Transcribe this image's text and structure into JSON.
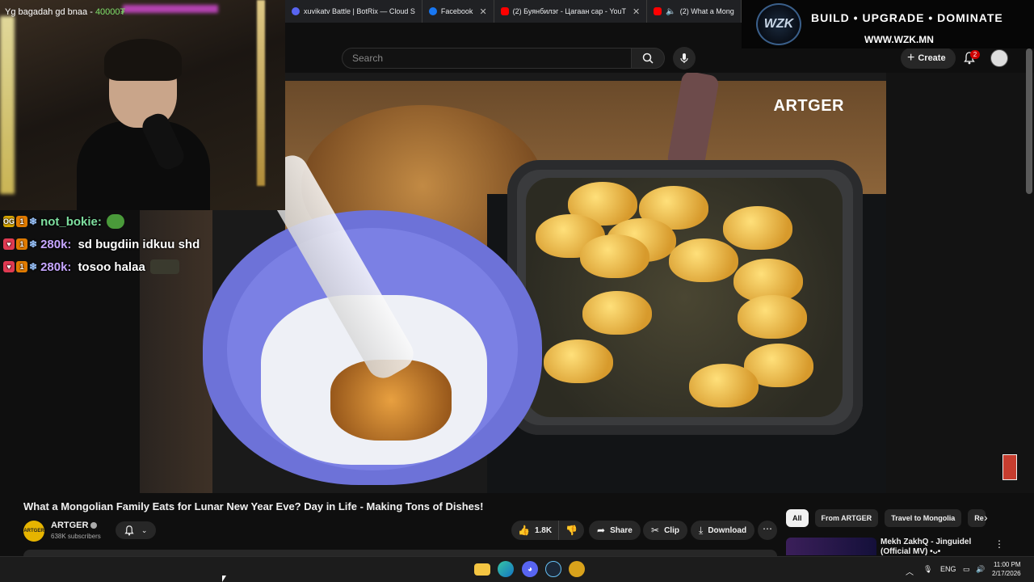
{
  "browser": {
    "tabs": [
      {
        "label": "xuvikatv Battle | BotRix — Cloud S",
        "icon": "botrix-icon",
        "color": "#5865f2",
        "has_close": false
      },
      {
        "label": "Facebook",
        "icon": "facebook-icon",
        "color": "#1877f2",
        "has_close": true
      },
      {
        "label": "(2) Буянбилэг - Цагаан сар - YouT",
        "icon": "youtube-icon",
        "color": "#ff0000",
        "has_close": true
      },
      {
        "label": "(2) What a Mong",
        "icon": "youtube-icon",
        "color": "#ff0000",
        "has_close": false,
        "audio": true
      }
    ]
  },
  "youtube": {
    "search_placeholder": "Search",
    "create_label": "Create",
    "notification_count": "2"
  },
  "banner": {
    "logo_text": "WZK",
    "tagline": "BUILD • UPGRADE • DOMINATE",
    "url": "WWW.WZK.MN"
  },
  "stream_overlay": {
    "goal_text": "Yg bagadah gd bnaa - ",
    "goal_value": "40000₮"
  },
  "chat": [
    {
      "badges": [
        "OG",
        "1"
      ],
      "user": "not_bokie:",
      "message": "",
      "emote": "pepe-emote"
    },
    {
      "badges": [
        "heart",
        "1"
      ],
      "user": "280k:",
      "message": "sd bugdiin idkuu shd",
      "emote": ""
    },
    {
      "badges": [
        "heart",
        "1"
      ],
      "user": "280k:",
      "message": "tosoo halaa",
      "emote": "dark-emote"
    }
  ],
  "video": {
    "watermark": "ARTGER",
    "title": "What a Mongolian Family Eats for Lunar New Year Eve? Day in Life - Making Tons of Dishes!"
  },
  "channel": {
    "avatar_text": "ARTGER",
    "name": "ARTGER",
    "subscribers": "638K subscribers"
  },
  "actions": {
    "likes": "1.8K",
    "share": "Share",
    "clip": "Clip",
    "download": "Download"
  },
  "chips": [
    "All",
    "From ARTGER",
    "Travel to Mongolia",
    "Re"
  ],
  "recommendation": {
    "title": "Mekh ZakhQ - Jinguidel (Official MV) •ᴗ•"
  },
  "taskbar": {
    "apps": [
      "windows-start",
      "file-explorer",
      "edge",
      "discord",
      "steam",
      "app-icon"
    ],
    "language": "ENG",
    "time": "11:00 PM",
    "date": "2/17/2026"
  },
  "colors": {
    "youtube_bg": "#0f0f0f",
    "pill_bg": "#272727",
    "accent_red": "#cc0000",
    "chat_green": "#7fe06a"
  }
}
